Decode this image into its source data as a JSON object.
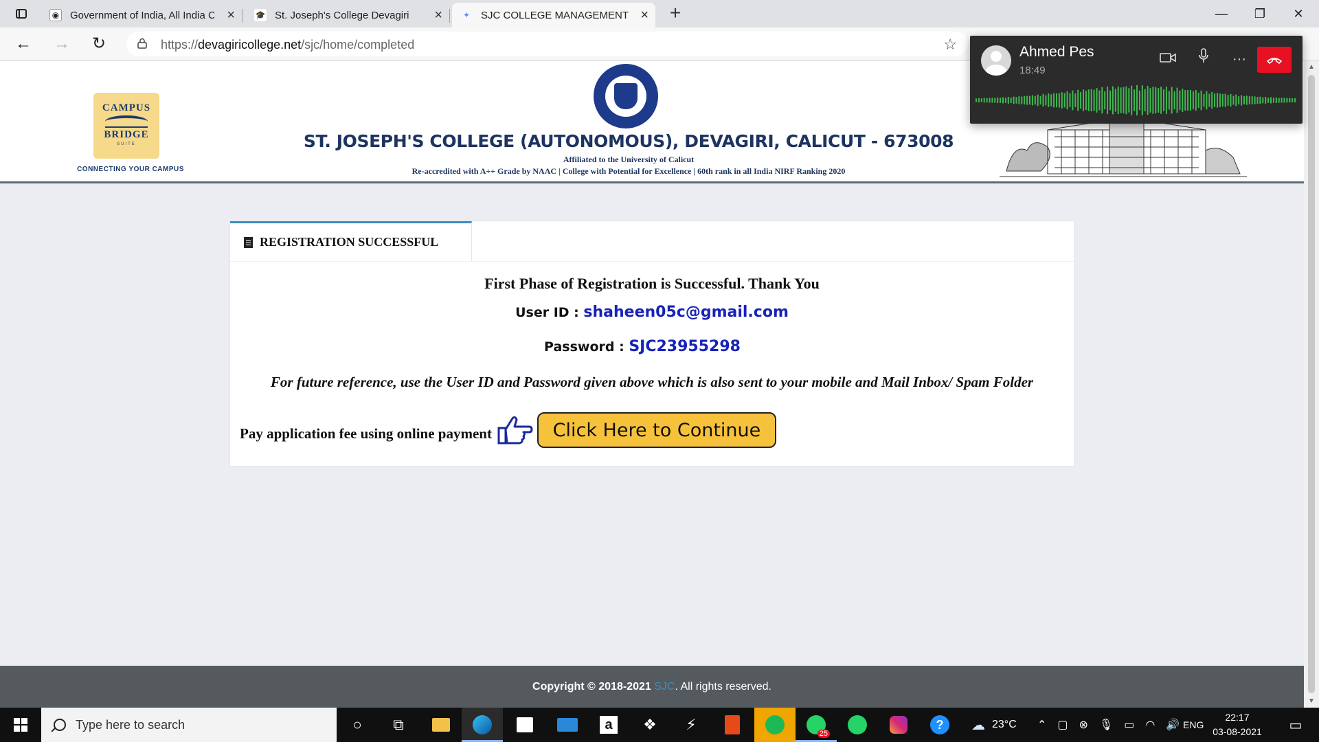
{
  "browser": {
    "tabs": [
      {
        "title": "Government of India, All India Co",
        "icon": "govt-favicon",
        "active": false
      },
      {
        "title": "St. Joseph's College Devagiri",
        "icon": "graduation-cap-favicon",
        "active": false
      },
      {
        "title": "SJC COLLEGE MANAGEMENT",
        "icon": "star-loading-favicon",
        "active": true
      }
    ],
    "url_prefix": "https://",
    "url_host": "devagiricollege.net",
    "url_path": "/sjc/home/completed"
  },
  "header": {
    "logo_line1": "CAMPUS",
    "logo_line2": "BRIDGE",
    "logo_line3": "SUITE",
    "logo_tagline": "CONNECTING YOUR CAMPUS",
    "college_name": "ST. JOSEPH'S COLLEGE (AUTONOMOUS), DEVAGIRI, CALICUT - 673008",
    "affiliation": "Affiliated to the University of Calicut",
    "accreditation": "Re-accredited with A++ Grade by NAAC | College with Potential for Excellence | 60th rank in all India NIRF Ranking 2020"
  },
  "card": {
    "tab_label": "REGISTRATION SUCCESSFUL",
    "title": "First Phase of Registration is Successful. Thank You",
    "user_id_label": "User ID :",
    "user_id_value": "shaheen05c@gmail.com",
    "password_label": "Password :",
    "password_value": "SJC23955298",
    "reference_note": "For future reference, use the User ID and Password given above which is also sent to your mobile and Mail Inbox/ Spam Folder",
    "pay_label": "Pay application fee using online payment",
    "continue_button": "Click Here to Continue"
  },
  "footer": {
    "copyright": "Copyright © 2018-2021",
    "brand": "SJC",
    "rest": ". All rights reserved."
  },
  "call": {
    "name": "Ahmed Pes",
    "duration": "18:49",
    "accent": "#e81123",
    "wave_color": "#3fb950"
  },
  "taskbar": {
    "search_placeholder": "Type here to search",
    "whatsapp_badge": "25",
    "temperature": "23°C",
    "language": "ENG",
    "time": "22:17",
    "date": "03-08-2021"
  },
  "colors": {
    "brand_navy": "#1d3461",
    "credential_blue": "#1722b8",
    "button_yellow": "#f7c23b",
    "tab_accent": "#3c8dbc"
  }
}
